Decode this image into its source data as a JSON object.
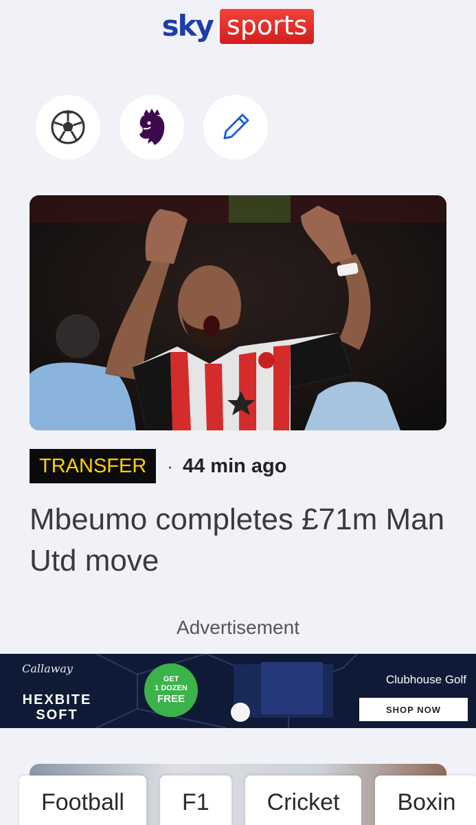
{
  "header": {
    "logo_sky": "sky",
    "logo_sports": "sports"
  },
  "shortcuts": [
    {
      "icon": "football-icon"
    },
    {
      "icon": "premier-league-lion-icon"
    },
    {
      "icon": "pencil-icon"
    }
  ],
  "article": {
    "tag": "TRANSFER",
    "separator": "·",
    "time": "44 min ago",
    "headline": "Mbeumo completes £71m Man Utd move",
    "image_icon": "player-photo"
  },
  "advertisement": {
    "label": "Advertisement",
    "brand": "Callaway",
    "model": "HEXBITE SOFT",
    "offer_top": "GET",
    "offer_mid": "1 DOZEN",
    "offer_bottom": "FREE",
    "store": "Clubhouse Golf",
    "cta": "SHOP NOW"
  },
  "sport_tabs": [
    "Football",
    "F1",
    "Cricket",
    "Boxin"
  ],
  "colors": {
    "accent_tag_bg": "#0b0b0b",
    "accent_tag_text": "#ffd200",
    "brand_red": "#e12a2a",
    "brand_blue": "#1b3ea8"
  }
}
